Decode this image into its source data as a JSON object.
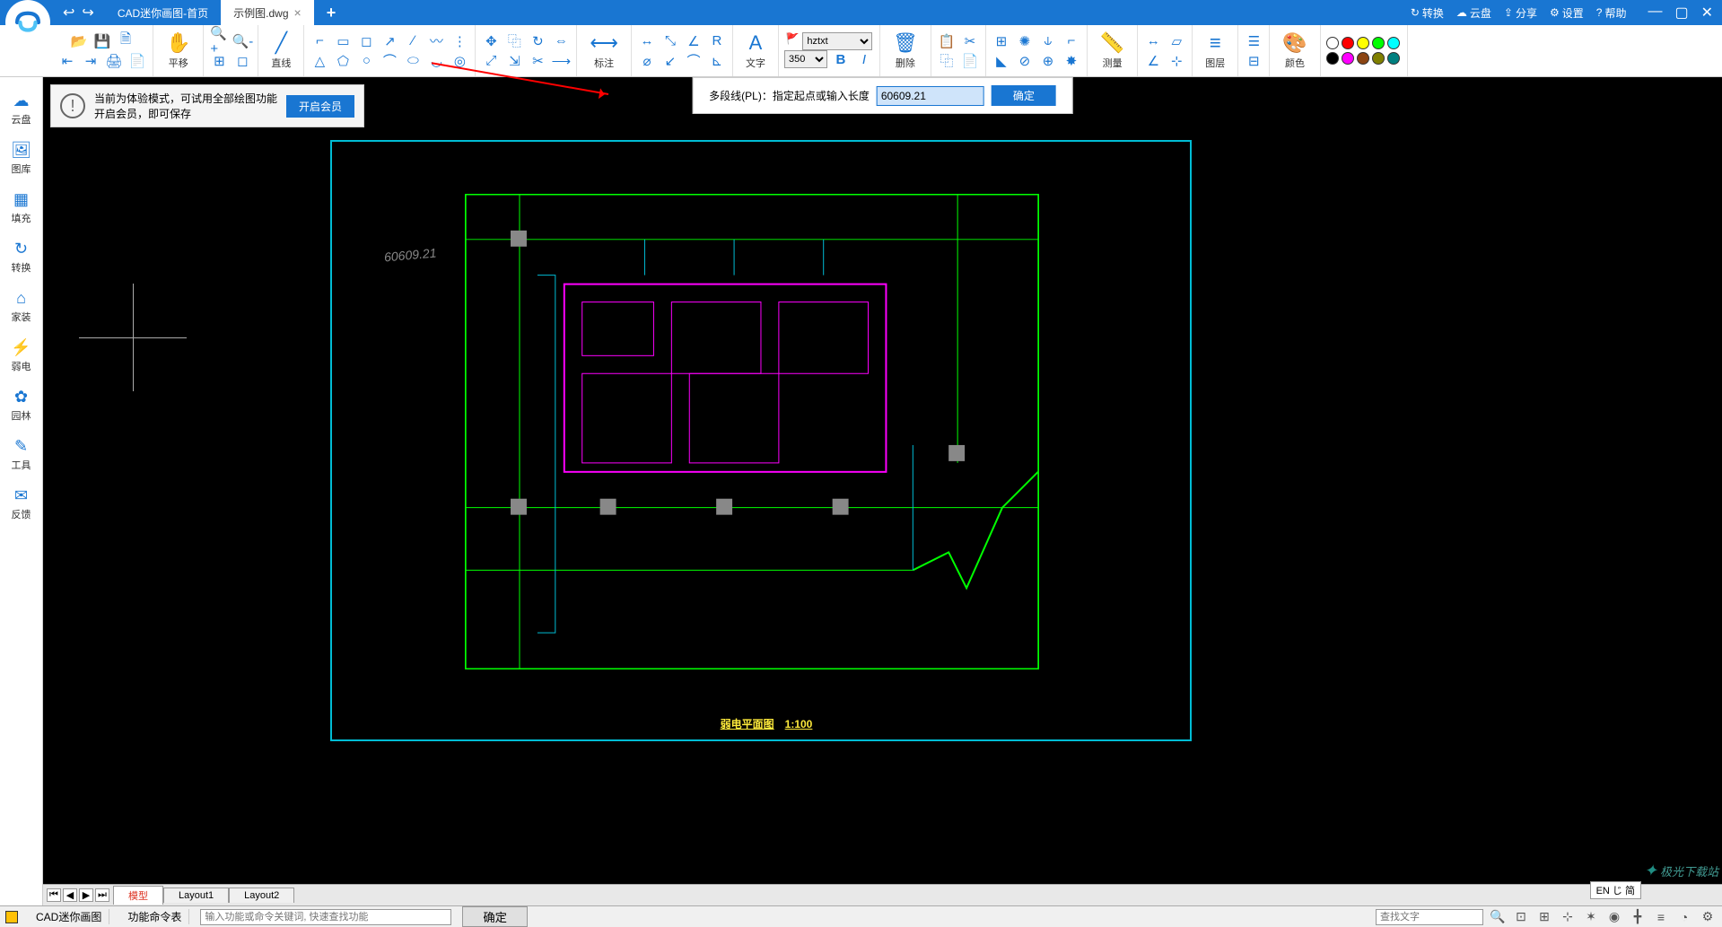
{
  "titlebar": {
    "tabs": [
      {
        "label": "CAD迷你画图-首页",
        "active": false
      },
      {
        "label": "示例图.dwg",
        "active": true
      }
    ],
    "right": {
      "convert": "转换",
      "cloud": "云盘",
      "share": "分享",
      "settings": "设置",
      "help": "帮助"
    }
  },
  "ribbon": {
    "pan": "平移",
    "line": "直线",
    "annotate": "标注",
    "text": "文字",
    "delete": "删除",
    "measure": "测量",
    "layer": "图层",
    "color": "颜色",
    "fontName": "hztxt",
    "fontSize": "350",
    "bold": "B",
    "italic": "I",
    "swatches": [
      "#ffffff",
      "#ff0000",
      "#ffff00",
      "#00ff00",
      "#00ffff",
      "#000000",
      "#ff00ff",
      "#8b4513",
      "#808000",
      "#008080"
    ]
  },
  "sidebar": [
    {
      "icon": "☁",
      "label": "云盘"
    },
    {
      "icon": "🖼",
      "label": "图库"
    },
    {
      "icon": "▦",
      "label": "填充"
    },
    {
      "icon": "↻",
      "label": "转换"
    },
    {
      "icon": "⌂",
      "label": "家装"
    },
    {
      "icon": "⚡",
      "label": "弱电"
    },
    {
      "icon": "✿",
      "label": "园林"
    },
    {
      "icon": "✎",
      "label": "工具"
    },
    {
      "icon": "✉",
      "label": "反馈"
    }
  ],
  "notice": {
    "line1": "当前为体验模式，可试用全部绘图功能",
    "line2": "开启会员，即可保存",
    "button": "开启会员"
  },
  "command": {
    "label": "多段线(PL)：指定起点或输入长度",
    "value": "60609.21",
    "ok": "确定"
  },
  "drawing": {
    "dimText": "60609.21",
    "title": "弱电平面图",
    "scale": "1:100"
  },
  "layoutTabs": {
    "model": "模型",
    "layout1": "Layout1",
    "layout2": "Layout2",
    "lang": "EN じ 简"
  },
  "watermark": "极光下载站",
  "statusbar": {
    "appName": "CAD迷你画图",
    "cmdTable": "功能命令表",
    "cmdPlaceholder": "输入功能或命令关键词, 快速查找功能",
    "ok": "确定",
    "searchPlaceholder": "查找文字"
  }
}
